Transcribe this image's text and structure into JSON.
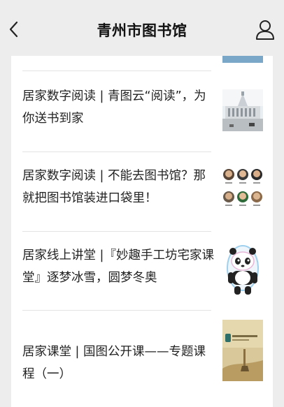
{
  "header": {
    "title": "青州市图书馆"
  },
  "articles": [
    {
      "title": "居家数字阅读 | 青图云“阅读”，为你送书到家",
      "thumbnail": "library-building-image"
    },
    {
      "title": "居家数字阅读 | 不能去图书馆？那就把图书馆装进口袋里！",
      "thumbnail": "speaker-portraits-image"
    },
    {
      "title": "居家线上讲堂 |『妙趣手工坊宅家课堂』逐梦冰雪，圆梦冬奥",
      "thumbnail": "panda-mascot-image"
    },
    {
      "title": "居家课堂 | 国图公开课——专题课程（一）",
      "thumbnail": "course-cover-image"
    }
  ],
  "colors": {
    "background": "#ededed",
    "card": "#ffffff",
    "divider": "#e3e3e3",
    "text": "#222222"
  }
}
